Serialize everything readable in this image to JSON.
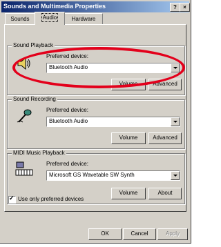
{
  "window": {
    "title": "Sounds and Multimedia Properties",
    "help_label": "?",
    "close_label": "×"
  },
  "tabs": [
    {
      "label": "Sounds",
      "active": false
    },
    {
      "label": "Audio",
      "active": true
    },
    {
      "label": "Hardware",
      "active": false
    }
  ],
  "playback": {
    "group_label": "Sound Playback",
    "device_label": "Preferred device:",
    "device_value": "Bluetooth Audio",
    "volume_label": "Volume",
    "advanced_label": "Advanced"
  },
  "recording": {
    "group_label": "Sound Recording",
    "device_label": "Preferred device:",
    "device_value": "Bluetooth Audio",
    "volume_label": "Volume",
    "advanced_label": "Advanced"
  },
  "midi": {
    "group_label": "MIDI Music Playback",
    "device_label": "Preferred device:",
    "device_value": "Microsoft GS Wavetable SW Synth",
    "volume_label": "Volume",
    "about_label": "About"
  },
  "preferred_only": {
    "label": "Use only preferred devices",
    "checked": true
  },
  "footer": {
    "ok_label": "OK",
    "cancel_label": "Cancel",
    "apply_label": "Apply"
  },
  "highlight_color": "#e3001b"
}
